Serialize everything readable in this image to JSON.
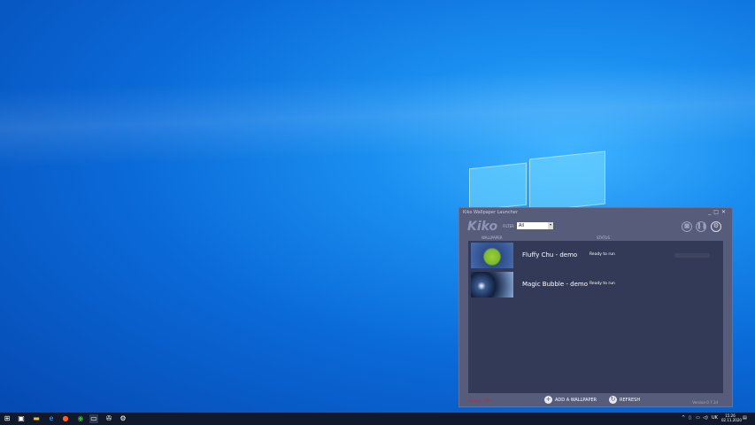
{
  "window": {
    "title": "Kiko Wallpaper Launcher",
    "controls": [
      "_",
      "□",
      "✕"
    ]
  },
  "header": {
    "logo": "Kiko",
    "filter_label": "FILTER",
    "filter_value": "All",
    "icons": [
      "stop-icon",
      "pause-icon",
      "settings-icon"
    ]
  },
  "columns": {
    "wallpaper": "WALLPAPER",
    "status": "STATUS"
  },
  "wallpapers": [
    {
      "name": "Fluffy Chu - demo",
      "status": "Ready to run"
    },
    {
      "name": "Magic Bubble - demo",
      "status": "Ready to run"
    }
  ],
  "footer": {
    "donate": "Donate 100%",
    "add": "ADD A WALLPAPER",
    "refresh": "REFRESH",
    "version": "Version 0.7.1d"
  },
  "taskbar": {
    "lang": "UK",
    "time": "15:26",
    "date": "02.11.2020"
  }
}
